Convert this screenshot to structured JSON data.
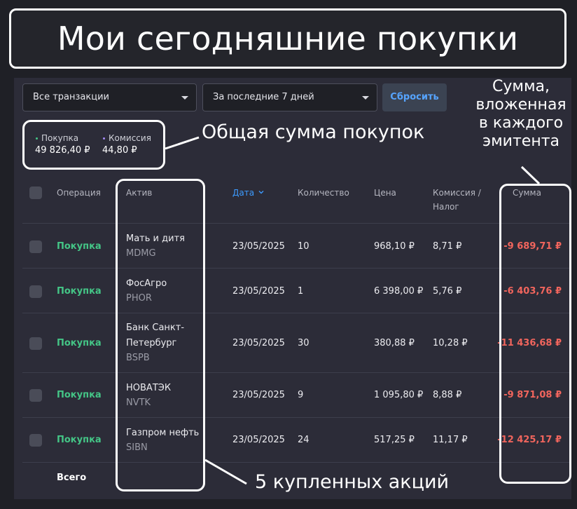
{
  "headline": "Мои сегодняшние покупки",
  "filters": {
    "transactions_value": "Все транзакции",
    "period_value": "За последние 7 дней",
    "reset_label": "Сбросить"
  },
  "summary": {
    "purchase_label": "Покупка",
    "purchase_value": "49 826,40 ₽",
    "commission_label": "Комиссия",
    "commission_value": "44,80 ₽"
  },
  "table": {
    "headers": {
      "operation": "Операция",
      "asset": "Актив",
      "date": "Дата",
      "quantity": "Количество",
      "price": "Цена",
      "commission_line1": "Комиссия /",
      "commission_line2": "Налог",
      "sum": "Сумма"
    },
    "sorted_by": "date",
    "rows": [
      {
        "operation": "Покупка",
        "asset_line1": "Мать и дитя",
        "asset_line2": "",
        "ticker": "MDMG",
        "date": "23/05/2025",
        "quantity": "10",
        "price": "968,10 ₽",
        "commission": "8,71 ₽",
        "sum": "-9 689,71 ₽"
      },
      {
        "operation": "Покупка",
        "asset_line1": "ФосАгро",
        "asset_line2": "",
        "ticker": "PHOR",
        "date": "23/05/2025",
        "quantity": "1",
        "price": "6 398,00 ₽",
        "commission": "5,76 ₽",
        "sum": "-6 403,76 ₽"
      },
      {
        "operation": "Покупка",
        "asset_line1": "Банк Санкт-",
        "asset_line2": "Петербург",
        "ticker": "BSPB",
        "date": "23/05/2025",
        "quantity": "30",
        "price": "380,88 ₽",
        "commission": "10,28 ₽",
        "sum": "-11 436,68 ₽"
      },
      {
        "operation": "Покупка",
        "asset_line1": "НОВАТЭК",
        "asset_line2": "",
        "ticker": "NVTK",
        "date": "23/05/2025",
        "quantity": "9",
        "price": "1 095,80 ₽",
        "commission": "8,88 ₽",
        "sum": "-9 871,08 ₽"
      },
      {
        "operation": "Покупка",
        "asset_line1": "Газпром нефть",
        "asset_line2": "",
        "ticker": "SIBN",
        "date": "23/05/2025",
        "quantity": "24",
        "price": "517,25 ₽",
        "commission": "11,17 ₽",
        "sum": "-12 425,17 ₽"
      }
    ],
    "total_label": "Всего"
  },
  "annotations": {
    "total_purchases": "Общая сумма покупок",
    "sum_per_issuer": [
      "Сумма,",
      "вложенная",
      "в каждого",
      "эмитента"
    ],
    "five_shares": "5 купленных акций"
  },
  "colors": {
    "background": "#1f2026",
    "panel": "#2c2c38",
    "purchase_green": "#44c586",
    "negative_red": "#f1655d",
    "accent_blue": "#3d9bff",
    "commission_purple": "#a78bfa"
  }
}
